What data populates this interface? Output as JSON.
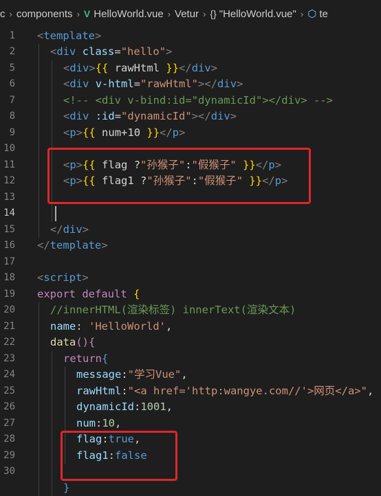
{
  "breadcrumb": {
    "items": [
      "c",
      "components",
      "HelloWorld.vue",
      "Vetur",
      "\"HelloWorld.vue\"",
      "te"
    ],
    "vue_icon": "V",
    "braces_icon": "{}",
    "cube_icon": "cube-icon"
  },
  "editor": {
    "active_line": "14",
    "lines": [
      {
        "n": "1",
        "indent": 0,
        "segments": [
          [
            "t-brk",
            "<"
          ],
          [
            "t-tag",
            "template"
          ],
          [
            "t-brk",
            ">"
          ]
        ]
      },
      {
        "n": "2",
        "indent": 1,
        "segments": [
          [
            "t-brk",
            "<"
          ],
          [
            "t-tag",
            "div"
          ],
          [
            "t-txt",
            " "
          ],
          [
            "t-attr",
            "class"
          ],
          [
            "t-txt",
            "="
          ],
          [
            "t-str",
            "\"hello\""
          ],
          [
            "t-brk",
            ">"
          ]
        ]
      },
      {
        "n": "5",
        "indent": 2,
        "segments": [
          [
            "t-brk",
            "<"
          ],
          [
            "t-tag",
            "div"
          ],
          [
            "t-brk",
            ">"
          ],
          [
            "t-mus",
            "{{"
          ],
          [
            "t-txt",
            " rawHtml "
          ],
          [
            "t-mus",
            "}}"
          ],
          [
            "t-brk",
            "</"
          ],
          [
            "t-tag",
            "div"
          ],
          [
            "t-brk",
            ">"
          ]
        ]
      },
      {
        "n": "6",
        "indent": 2,
        "segments": [
          [
            "t-brk",
            "<"
          ],
          [
            "t-tag",
            "div"
          ],
          [
            "t-txt",
            " "
          ],
          [
            "t-attr",
            "v-html"
          ],
          [
            "t-txt",
            "="
          ],
          [
            "t-str",
            "\"rawHtml\""
          ],
          [
            "t-brk",
            "></"
          ],
          [
            "t-tag",
            "div"
          ],
          [
            "t-brk",
            ">"
          ]
        ]
      },
      {
        "n": "7",
        "indent": 2,
        "segments": [
          [
            "t-cmt",
            "<!-- <div v-bind:id=\"dynamicId\"></div> -->"
          ]
        ]
      },
      {
        "n": "8",
        "indent": 2,
        "segments": [
          [
            "t-brk",
            "<"
          ],
          [
            "t-tag",
            "div"
          ],
          [
            "t-txt",
            " "
          ],
          [
            "t-attr",
            ":id"
          ],
          [
            "t-txt",
            "="
          ],
          [
            "t-str",
            "\"dynamicId\""
          ],
          [
            "t-brk",
            "></"
          ],
          [
            "t-tag",
            "div"
          ],
          [
            "t-brk",
            ">"
          ]
        ]
      },
      {
        "n": "9",
        "indent": 2,
        "segments": [
          [
            "t-brk",
            "<"
          ],
          [
            "t-tag",
            "p"
          ],
          [
            "t-brk",
            ">"
          ],
          [
            "t-mus",
            "{{"
          ],
          [
            "t-txt",
            " num+10 "
          ],
          [
            "t-mus",
            "}}"
          ],
          [
            "t-brk",
            "</"
          ],
          [
            "t-tag",
            "p"
          ],
          [
            "t-brk",
            ">"
          ]
        ]
      },
      {
        "n": "10",
        "indent": 2,
        "segments": []
      },
      {
        "n": "11",
        "indent": 2,
        "segments": [
          [
            "t-brk",
            "<"
          ],
          [
            "t-tag",
            "p"
          ],
          [
            "t-brk",
            ">"
          ],
          [
            "t-mus",
            "{{"
          ],
          [
            "t-txt",
            " flag ?"
          ],
          [
            "t-str",
            "\"孙猴子\""
          ],
          [
            "t-txt",
            ":"
          ],
          [
            "t-str",
            "\"假猴子\""
          ],
          [
            "t-txt",
            " "
          ],
          [
            "t-mus",
            "}}"
          ],
          [
            "t-brk",
            "</"
          ],
          [
            "t-tag",
            "p"
          ],
          [
            "t-brk",
            ">"
          ]
        ]
      },
      {
        "n": "12",
        "indent": 2,
        "segments": [
          [
            "t-brk",
            "<"
          ],
          [
            "t-tag",
            "p"
          ],
          [
            "t-brk",
            ">"
          ],
          [
            "t-mus",
            "{{"
          ],
          [
            "t-txt",
            " flag1 ?"
          ],
          [
            "t-str",
            "\"孙猴子\""
          ],
          [
            "t-txt",
            ":"
          ],
          [
            "t-str",
            "\"假猴子\""
          ],
          [
            "t-txt",
            " "
          ],
          [
            "t-mus",
            "}}"
          ],
          [
            "t-brk",
            "</"
          ],
          [
            "t-tag",
            "p"
          ],
          [
            "t-brk",
            ">"
          ]
        ]
      },
      {
        "n": "13",
        "indent": 2,
        "segments": []
      },
      {
        "n": "14",
        "indent": 2,
        "segments": []
      },
      {
        "n": "15",
        "indent": 1,
        "segments": [
          [
            "t-brk",
            "</"
          ],
          [
            "t-tag",
            "div"
          ],
          [
            "t-brk",
            ">"
          ]
        ]
      },
      {
        "n": "16",
        "indent": 0,
        "segments": [
          [
            "t-brk",
            "</"
          ],
          [
            "t-tag",
            "template"
          ],
          [
            "t-brk",
            ">"
          ]
        ]
      },
      {
        "n": "17",
        "indent": 0,
        "segments": []
      },
      {
        "n": "18",
        "indent": 0,
        "segments": [
          [
            "t-brk",
            "<"
          ],
          [
            "t-tag",
            "script"
          ],
          [
            "t-brk",
            ">"
          ]
        ]
      },
      {
        "n": "19",
        "indent": 0,
        "segments": [
          [
            "t-kw",
            "export"
          ],
          [
            "t-txt",
            " "
          ],
          [
            "t-kw",
            "default"
          ],
          [
            "t-txt",
            " "
          ],
          [
            "t-mus",
            "{"
          ]
        ]
      },
      {
        "n": "20",
        "indent": 1,
        "segments": [
          [
            "t-cmt",
            "//innerHTML(渲染标签) innerText(渲染文本)"
          ]
        ]
      },
      {
        "n": "21",
        "indent": 1,
        "segments": [
          [
            "t-var",
            "name"
          ],
          [
            "t-txt",
            ": "
          ],
          [
            "t-str",
            "'HelloWorld'"
          ],
          [
            "t-txt",
            ","
          ]
        ]
      },
      {
        "n": "22",
        "indent": 1,
        "segments": [
          [
            "t-fn",
            "data"
          ],
          [
            "t-kw",
            "()"
          ],
          [
            "t-kw",
            "{"
          ]
        ]
      },
      {
        "n": "23",
        "indent": 2,
        "segments": [
          [
            "t-kw",
            "return"
          ],
          [
            "t-blue",
            "{"
          ]
        ]
      },
      {
        "n": "24",
        "indent": 3,
        "segments": [
          [
            "t-var",
            "message"
          ],
          [
            "t-txt",
            ":"
          ],
          [
            "t-str",
            "\"学习Vue\""
          ],
          [
            "t-txt",
            ","
          ]
        ]
      },
      {
        "n": "25",
        "indent": 3,
        "segments": [
          [
            "t-var",
            "rawHtml"
          ],
          [
            "t-txt",
            ":"
          ],
          [
            "t-str",
            "\"<a href='http:wangye.com//'>网页</a>\""
          ],
          [
            "t-txt",
            ","
          ]
        ]
      },
      {
        "n": "26",
        "indent": 3,
        "segments": [
          [
            "t-var",
            "dynamicId"
          ],
          [
            "t-txt",
            ":"
          ],
          [
            "t-num",
            "1001"
          ],
          [
            "t-txt",
            ","
          ]
        ]
      },
      {
        "n": "27",
        "indent": 3,
        "segments": [
          [
            "t-var",
            "num"
          ],
          [
            "t-txt",
            ":"
          ],
          [
            "t-num",
            "10"
          ],
          [
            "t-txt",
            ","
          ]
        ]
      },
      {
        "n": "28",
        "indent": 3,
        "segments": [
          [
            "t-var",
            "flag"
          ],
          [
            "t-txt",
            ":"
          ],
          [
            "t-blue",
            "true"
          ],
          [
            "t-txt",
            ","
          ]
        ]
      },
      {
        "n": "29",
        "indent": 3,
        "segments": [
          [
            "t-var",
            "flag1"
          ],
          [
            "t-txt",
            ":"
          ],
          [
            "t-blue",
            "false"
          ]
        ]
      },
      {
        "n": "30",
        "indent": 2,
        "segments": []
      },
      {
        "n": "",
        "indent": 2,
        "segments": [
          [
            "t-blue",
            "}"
          ]
        ]
      }
    ]
  },
  "highlight_color": "#e0262b"
}
